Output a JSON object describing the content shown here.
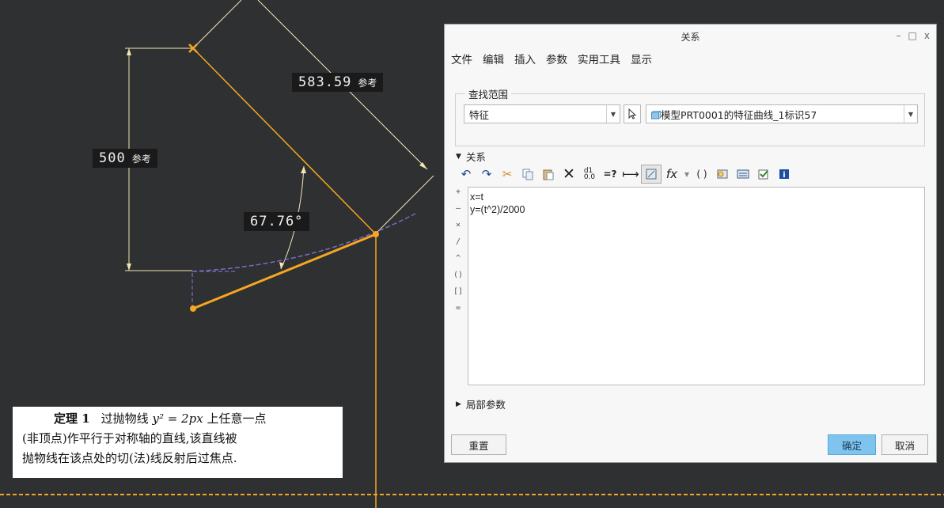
{
  "cad_view": {
    "dims": {
      "length_value": "583.59",
      "height_value": "500",
      "angle_value": "67.76°",
      "ref_label": "参考"
    },
    "colors": {
      "background": "#2e3031",
      "sketch_orange": "#f5a623",
      "dimension": "#f2e6b4",
      "curve_dashed": "#7a6cc4"
    }
  },
  "theorem": {
    "title": "定理 1",
    "line1_a": "过抛物线",
    "math": "y² = 2px",
    "line1_b": "上任意一点",
    "line2": "(非顶点)作平行于对称轴的直线,该直线被",
    "line3": "抛物线在该点处的切(法)线反射后过焦点."
  },
  "dialog": {
    "title": "关系",
    "window_buttons": {
      "minimize": "–",
      "maximize": "□",
      "close": "x"
    },
    "menu": [
      "文件",
      "编辑",
      "插入",
      "参数",
      "实用工具",
      "显示"
    ],
    "search_scope": {
      "legend": "查找范围",
      "type_value": "特征",
      "object_value": "模型PRT0001的特征曲线_1标识57"
    },
    "relations_section": "关系",
    "toolbar_icons": [
      "undo-icon",
      "redo-icon",
      "cut-icon",
      "copy-icon",
      "paste-icon",
      "delete-icon",
      "sort-icon",
      "evaluate-icon",
      "insert-dimension-icon",
      "show-dimension-icon",
      "function-icon",
      "dropdown-icon",
      "brackets-icon",
      "parameter-icon",
      "units-icon",
      "verify-icon",
      "info-icon"
    ],
    "operators": [
      "+",
      "–",
      "×",
      "/",
      "^",
      "()",
      "[]",
      "="
    ],
    "relations_text": [
      "x=t",
      "y=(t^2)/2000"
    ],
    "local_params_section": "局部参数",
    "buttons": {
      "reset": "重置",
      "ok": "确定",
      "cancel": "取消"
    }
  }
}
